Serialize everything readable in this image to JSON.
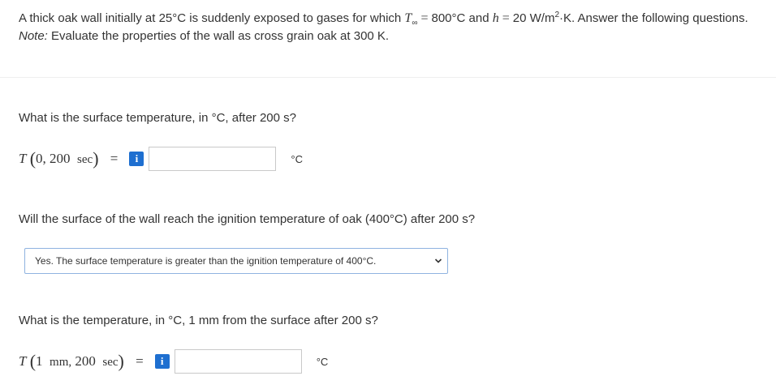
{
  "problem": {
    "line1_pre": "A thick oak wall initially at 25°C is suddenly exposed to gases for which ",
    "t_inf_symbol": "T",
    "t_inf_sub": "∞",
    "eq": "=",
    "t_inf_value": "800°C and ",
    "h_symbol": "h",
    "h_value": "20 W/m",
    "h_exp": "2",
    "h_unit_tail": "·K. Answer the following questions.",
    "note_label": "Note:",
    "note_text": " Evaluate the properties of the wall as cross grain oak at 300 K."
  },
  "q1": {
    "text": "What is the surface temperature, in °C, after 200 s?",
    "lhs_var": "T",
    "lhs_args": "0, 200",
    "lhs_unit": "sec",
    "eq": "=",
    "info": "i",
    "value": "",
    "unit": "°C"
  },
  "q2": {
    "text": "Will the surface of the wall reach the ignition temperature of oak (400°C) after 200 s?",
    "selected": "Yes. The surface temperature is greater than the ignition temperature of 400°C."
  },
  "q3": {
    "text": "What is the temperature, in °C, 1 mm from the surface after 200 s?",
    "lhs_var": "T",
    "lhs_arg1": "1",
    "lhs_arg1_unit": "mm,",
    "lhs_arg2": "200",
    "lhs_unit": "sec",
    "eq": "=",
    "info": "i",
    "value": "",
    "unit": "°C"
  },
  "colors": {
    "info_button": "#1e6fd0",
    "select_border": "#8fb3e0",
    "text": "#333333"
  }
}
